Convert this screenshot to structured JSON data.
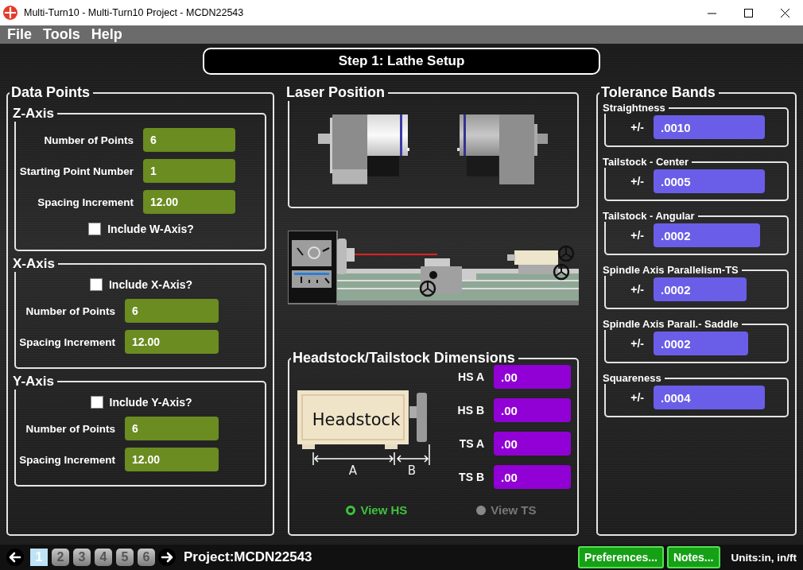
{
  "window": {
    "title": "Multi-Turn10 - Multi-Turn10 Project - MCDN22543"
  },
  "menu": [
    "File",
    "Tools",
    "Help"
  ],
  "step_title": "Step 1: Lathe Setup",
  "data_points": {
    "title": "Data Points",
    "groups": [
      {
        "title": "Z-Axis",
        "rows": [
          {
            "kind": "field",
            "label": "Number of Points",
            "value": "6"
          },
          {
            "kind": "field",
            "label": "Starting Point Number",
            "value": "1"
          },
          {
            "kind": "field",
            "label": "Spacing Increment",
            "value": "12.00"
          },
          {
            "kind": "checkbox",
            "label": "Include W-Axis?",
            "checked": false
          }
        ]
      },
      {
        "title": "X-Axis",
        "rows": [
          {
            "kind": "checkbox",
            "label": "Include X-Axis?",
            "checked": false
          },
          {
            "kind": "field",
            "label": "Number of Points",
            "value": "6"
          },
          {
            "kind": "field",
            "label": "Spacing Increment",
            "value": "12.00"
          }
        ]
      },
      {
        "title": "Y-Axis",
        "rows": [
          {
            "kind": "checkbox",
            "label": "Include Y-Axis?",
            "checked": false
          },
          {
            "kind": "field",
            "label": "Number of Points",
            "value": "6"
          },
          {
            "kind": "field",
            "label": "Spacing Increment",
            "value": "12.00"
          }
        ]
      }
    ]
  },
  "laser_position": {
    "title": "Laser Position"
  },
  "dimensions": {
    "title": "Headstock/Tailstock Dimensions",
    "diagram": {
      "label": "Headstock",
      "dim_a": "A",
      "dim_b": "B"
    },
    "fields": [
      {
        "label": "HS A",
        "value": ".00"
      },
      {
        "label": "HS B",
        "value": ".00"
      },
      {
        "label": "TS A",
        "value": ".00"
      },
      {
        "label": "TS B",
        "value": ".00"
      }
    ],
    "views": [
      {
        "label": "View HS",
        "selected": true
      },
      {
        "label": "View TS",
        "selected": false
      }
    ]
  },
  "tolerance_bands": {
    "title": "Tolerance Bands",
    "items": [
      {
        "title": "Straightness",
        "prefix": "+/-",
        "value": ".0010"
      },
      {
        "title": "Tailstock - Center",
        "prefix": "+/-",
        "value": ".0005"
      },
      {
        "title": "Tailstock - Angular",
        "prefix": "+/-",
        "value": ".0002"
      },
      {
        "title": "Spindle Axis Parallelism-TS",
        "prefix": "+/-",
        "value": ".0002"
      },
      {
        "title": "Spindle Axis Parall.- Saddle",
        "prefix": "+/-",
        "value": ".0002"
      },
      {
        "title": "Squareness",
        "prefix": "+/-",
        "value": ".0004"
      }
    ]
  },
  "status_bar": {
    "pages": [
      {
        "label": "1",
        "selected": true
      },
      {
        "label": "2",
        "selected": false
      },
      {
        "label": "3",
        "selected": false
      },
      {
        "label": "4",
        "selected": false
      },
      {
        "label": "5",
        "selected": false
      },
      {
        "label": "6",
        "selected": false
      }
    ],
    "project": "Project:MCDN22543",
    "buttons": [
      "Preferences...",
      "Notes..."
    ],
    "units": "Units:in, in/ft"
  }
}
